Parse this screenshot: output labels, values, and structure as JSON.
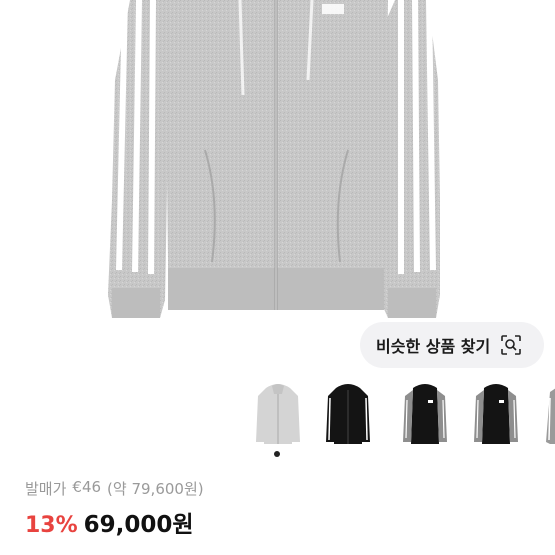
{
  "product": {
    "images": [
      "gray-zip-hoodie",
      "black-zip-hoodie",
      "black-hoodie-gray-sleeve",
      "black-hoodie-gray-sleeve-alt",
      "gray-hoodie-partial"
    ],
    "colors": {
      "heather": "#c9c9c9",
      "stripe": "#ffffff",
      "black": "#151515",
      "accent": "#e8433f"
    }
  },
  "similar_search": {
    "label": "비슷한 상품 찾기",
    "icon": "visual-search-icon"
  },
  "pricing": {
    "original_label": "발매가",
    "original_price": "€46",
    "original_krw": "(약 79,600원)",
    "discount": "13%",
    "sale_price": "69,000원"
  },
  "carousel": {
    "active_index": 1,
    "count": 1
  }
}
